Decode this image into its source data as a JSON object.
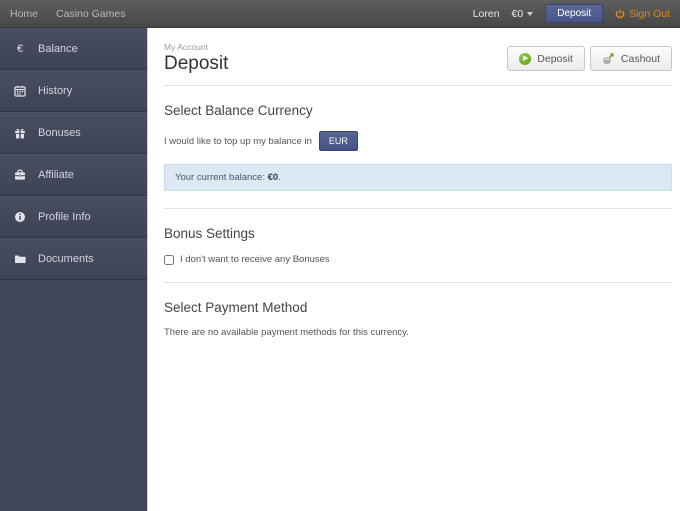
{
  "topbar": {
    "nav": [
      {
        "label": "Home"
      },
      {
        "label": "Casino Games"
      }
    ],
    "user": {
      "name": "Loren",
      "balance": "€0"
    },
    "deposit_label": "Deposit",
    "signout_label": "Sign Out"
  },
  "sidebar": {
    "items": [
      {
        "label": "Balance",
        "icon": "euro-icon"
      },
      {
        "label": "History",
        "icon": "calendar-icon"
      },
      {
        "label": "Bonuses",
        "icon": "gift-icon"
      },
      {
        "label": "Affiliate",
        "icon": "briefcase-icon"
      },
      {
        "label": "Profile Info",
        "icon": "info-icon"
      },
      {
        "label": "Documents",
        "icon": "folder-icon"
      }
    ]
  },
  "main": {
    "breadcrumb": "My Account",
    "title": "Deposit",
    "actions": {
      "deposit_label": "Deposit",
      "cashout_label": "Cashout"
    },
    "currency_section": {
      "heading": "Select Balance Currency",
      "prompt": "I would like to top up my balance in",
      "currency": "EUR",
      "balance_prefix": "Your current balance: ",
      "balance_value": "€0",
      "balance_suffix": "."
    },
    "bonus_section": {
      "heading": "Bonus Settings",
      "checkbox_label": "I don't want to receive any Bonuses",
      "checkbox_checked": false
    },
    "payment_section": {
      "heading": "Select Payment Method",
      "empty_message": "There are no available payment methods for this currency."
    }
  },
  "colors": {
    "accent_navy": "#4d5b8e",
    "signout_orange": "#e0881f",
    "success_green": "#6aa823",
    "sidebar_bg": "#404558",
    "info_box_bg": "#dde9f2"
  }
}
